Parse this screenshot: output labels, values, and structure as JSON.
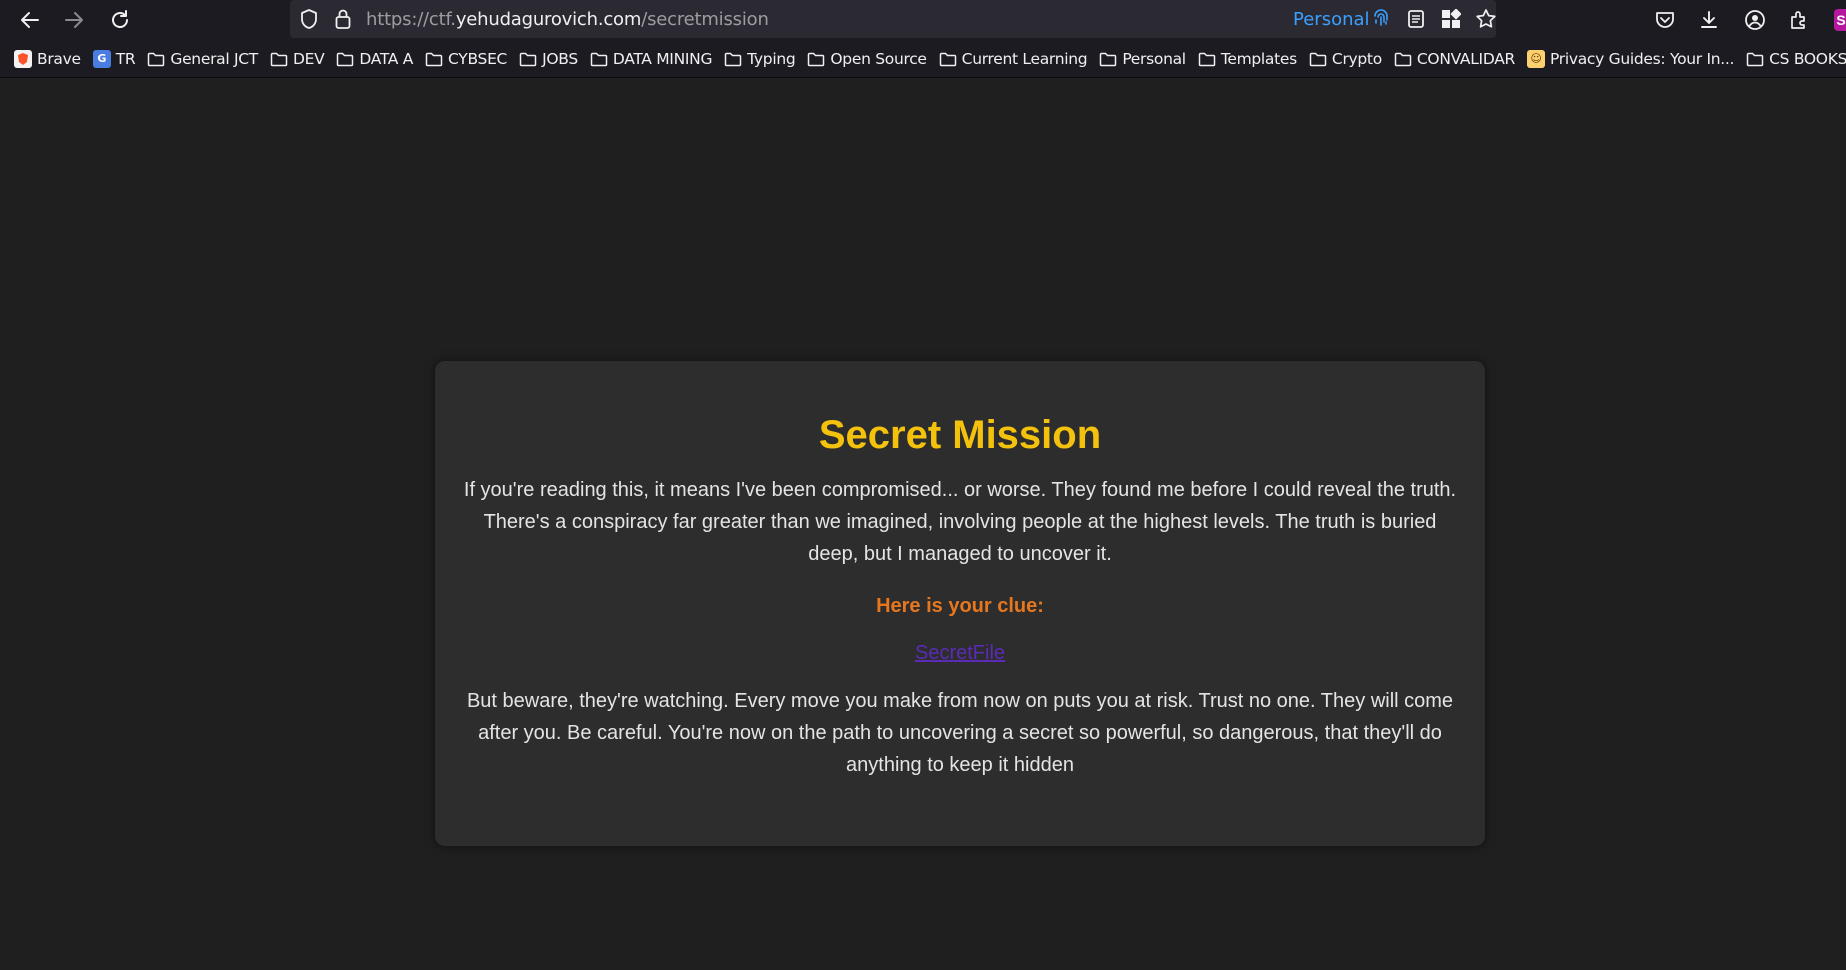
{
  "browser": {
    "url_prefix": "https://ctf.",
    "url_host": "yehudagurovich.com",
    "url_path": "/secretmission",
    "container_label": "Personal",
    "profile_initial": "S",
    "icons": [
      "back-icon",
      "forward-icon",
      "reload-icon",
      "shield-icon",
      "lock-icon",
      "fingerprint-icon",
      "reader-view-icon",
      "grid-icon",
      "star-icon",
      "pocket-icon",
      "download-icon",
      "account-icon",
      "extensions-icon"
    ]
  },
  "bookmarks": [
    {
      "label": "Brave",
      "icon": "brave-favicon"
    },
    {
      "label": "TR",
      "icon": "translate-favicon"
    },
    {
      "label": "General JCT",
      "icon": "folder-icon"
    },
    {
      "label": "DEV",
      "icon": "folder-icon"
    },
    {
      "label": "DATA A",
      "icon": "folder-icon"
    },
    {
      "label": "CYBSEC",
      "icon": "folder-icon"
    },
    {
      "label": "JOBS",
      "icon": "folder-icon"
    },
    {
      "label": "DATA MINING",
      "icon": "folder-icon"
    },
    {
      "label": "Typing",
      "icon": "folder-icon"
    },
    {
      "label": "Open Source",
      "icon": "folder-icon"
    },
    {
      "label": "Current Learning",
      "icon": "folder-icon"
    },
    {
      "label": "Personal",
      "icon": "folder-icon"
    },
    {
      "label": "Templates",
      "icon": "folder-icon"
    },
    {
      "label": "Crypto",
      "icon": "folder-icon"
    },
    {
      "label": "CONVALIDAR",
      "icon": "folder-icon"
    },
    {
      "label": "Privacy Guides: Your In...",
      "icon": "privacy-guides-favicon"
    },
    {
      "label": "CS BOOKS",
      "icon": "folder-icon"
    }
  ],
  "page": {
    "title": "Secret Mission",
    "intro": "If you're reading this, it means I've been compromised... or worse. They found me before I could reveal the truth. There's a conspiracy far greater than we imagined, involving people at the highest levels. The truth is buried deep, but I managed to uncover it.",
    "clue_label": "Here is your clue:",
    "clue_link": "SecretFile",
    "warning": "But beware, they're watching. Every move you make from now on puts you at risk. Trust no one. They will come after you. Be careful. You're now on the path to uncovering a secret so powerful, so dangerous, that they'll do anything to keep it hidden"
  },
  "colors": {
    "title": "#f4c20d",
    "clue": "#e7771f",
    "link": "#5b2bb5",
    "background": "#1f1f1f",
    "card": "#2d2d2d"
  }
}
